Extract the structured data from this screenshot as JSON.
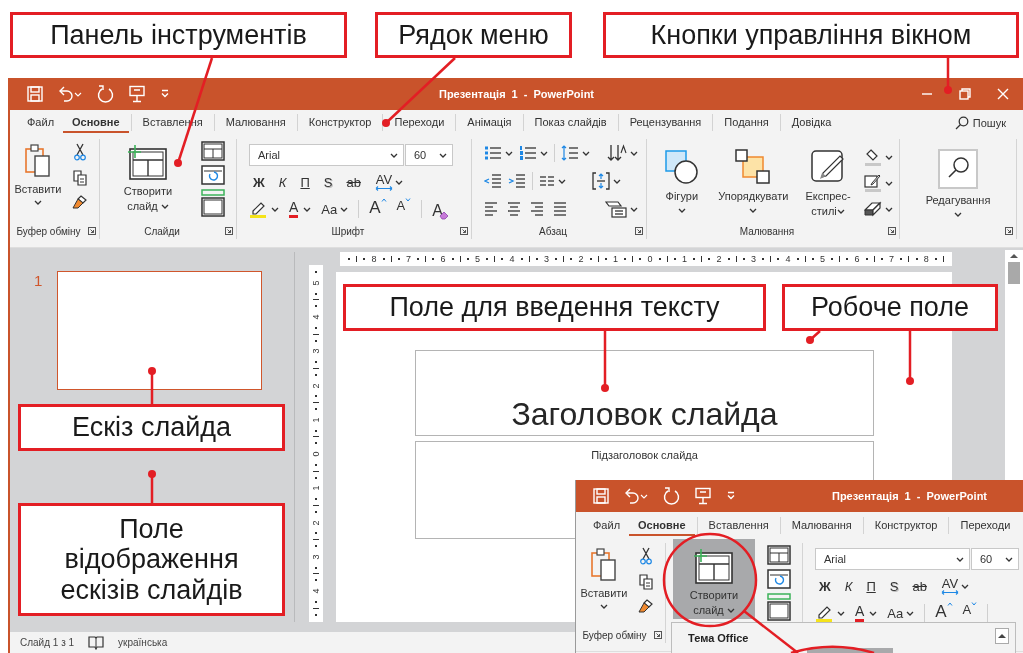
{
  "callouts": [
    {
      "text": "Панель інструментів"
    },
    {
      "text": "Рядок меню"
    },
    {
      "text": "Кнопки управління вікном"
    },
    {
      "text": "Поле для введення тексту"
    },
    {
      "text": "Робоче поле"
    },
    {
      "text": "Ескіз слайда"
    },
    {
      "text": "Поле відображення ескізів слайдів"
    }
  ],
  "window": {
    "title": "Презентація 1 - PowerPoint"
  },
  "tabs": [
    {
      "label": "Файл",
      "selected": false
    },
    {
      "label": "Основне",
      "selected": true
    },
    {
      "label": "Вставлення",
      "selected": false
    },
    {
      "label": "Малювання",
      "selected": false
    },
    {
      "label": "Конструктор",
      "selected": false
    },
    {
      "label": "Переходи",
      "selected": false
    },
    {
      "label": "Анімація",
      "selected": false
    },
    {
      "label": "Показ слайдів",
      "selected": false
    },
    {
      "label": "Рецензування",
      "selected": false
    },
    {
      "label": "Подання",
      "selected": false
    },
    {
      "label": "Довідка",
      "selected": false
    }
  ],
  "search": {
    "label": "Пошук"
  },
  "ribbon": {
    "groups": [
      {
        "kind": "clipboard",
        "title": "Буфер обміну",
        "paste": "Вставити"
      },
      {
        "kind": "slides",
        "title": "Слайди",
        "new_slide": {
          "label": "Створити слайд",
          "pressed": false
        }
      },
      {
        "kind": "font",
        "title": "Шрифт",
        "font_name": "Arial",
        "font_size": "60",
        "row_1": [
          {
            "kind": "bold",
            "label": "Ж"
          },
          {
            "kind": "italic",
            "label": "К"
          },
          {
            "kind": "underline",
            "label": "П"
          },
          {
            "kind": "shadow",
            "label": "S"
          },
          {
            "kind": "strike",
            "label": "ab"
          },
          {
            "kind": "spacing",
            "label": "AV"
          }
        ],
        "row_2": [
          {
            "kind": "highlight"
          },
          {
            "kind": "font_color",
            "label": "A"
          },
          {
            "kind": "case",
            "label": "Aa"
          },
          {
            "kind": "grow",
            "label": "A"
          },
          {
            "kind": "shrink",
            "label": "A"
          },
          {
            "kind": "clear",
            "label": "A"
          }
        ]
      },
      {
        "kind": "paragraph",
        "title": "Абзац"
      },
      {
        "kind": "drawing",
        "title": "Малювання",
        "shapes": "Фігури",
        "arrange": "Упорядкувати",
        "quick_styles": "Експрес-стилі"
      },
      {
        "kind": "editing",
        "label": "Редагування"
      }
    ]
  },
  "workspace": {
    "thumbnails": [
      {
        "number": "1",
        "selected": true
      }
    ],
    "horizontal_ruler": [
      "8",
      "7",
      "6",
      "5",
      "4",
      "3",
      "2",
      "1",
      "0",
      "1",
      "2",
      "3",
      "4",
      "5",
      "6",
      "7",
      "8"
    ],
    "vertical_ruler": [
      "5",
      "4",
      "3",
      "2",
      "1",
      "0",
      "1",
      "2",
      "3",
      "4"
    ],
    "slide": {
      "title": "Заголовок слайда",
      "subtitle": "Підзаголовок слайда"
    }
  },
  "status_bar": {
    "slide": "Слайд 1 з 1",
    "language": "українська"
  },
  "inset": {
    "window": {
      "title": "Презентація 1 - PowerPoint"
    },
    "tabs": [
      {
        "label": "Файл",
        "selected": false
      },
      {
        "label": "Основне",
        "selected": true
      },
      {
        "label": "Вставлення",
        "selected": false
      },
      {
        "label": "Малювання",
        "selected": false
      },
      {
        "label": "Конструктор",
        "selected": false
      },
      {
        "label": "Переходи",
        "selected": false
      }
    ],
    "ribbon": {
      "groups": [
        {
          "kind": "clipboard",
          "title": "Буфер обміну",
          "paste": "Вставити"
        },
        {
          "kind": "slides",
          "new_slide": {
            "label": "Створити слайд",
            "pressed": true
          }
        },
        {
          "kind": "font",
          "font_name": "Arial",
          "font_size": "60",
          "row_1": [
            {
              "kind": "bold",
              "label": "Ж"
            },
            {
              "kind": "italic",
              "label": "К"
            },
            {
              "kind": "underline",
              "label": "П"
            },
            {
              "kind": "shadow",
              "label": "S"
            },
            {
              "kind": "strike",
              "label": "ab"
            },
            {
              "kind": "spacing",
              "label": "AV"
            }
          ],
          "row_2": [
            {
              "kind": "highlight"
            },
            {
              "kind": "font_color",
              "label": "A"
            },
            {
              "kind": "case",
              "label": "Aa"
            },
            {
              "kind": "grow",
              "label": "A"
            },
            {
              "kind": "shrink",
              "label": "A"
            }
          ]
        }
      ]
    },
    "gallery": {
      "title": "Тема Office"
    }
  }
}
